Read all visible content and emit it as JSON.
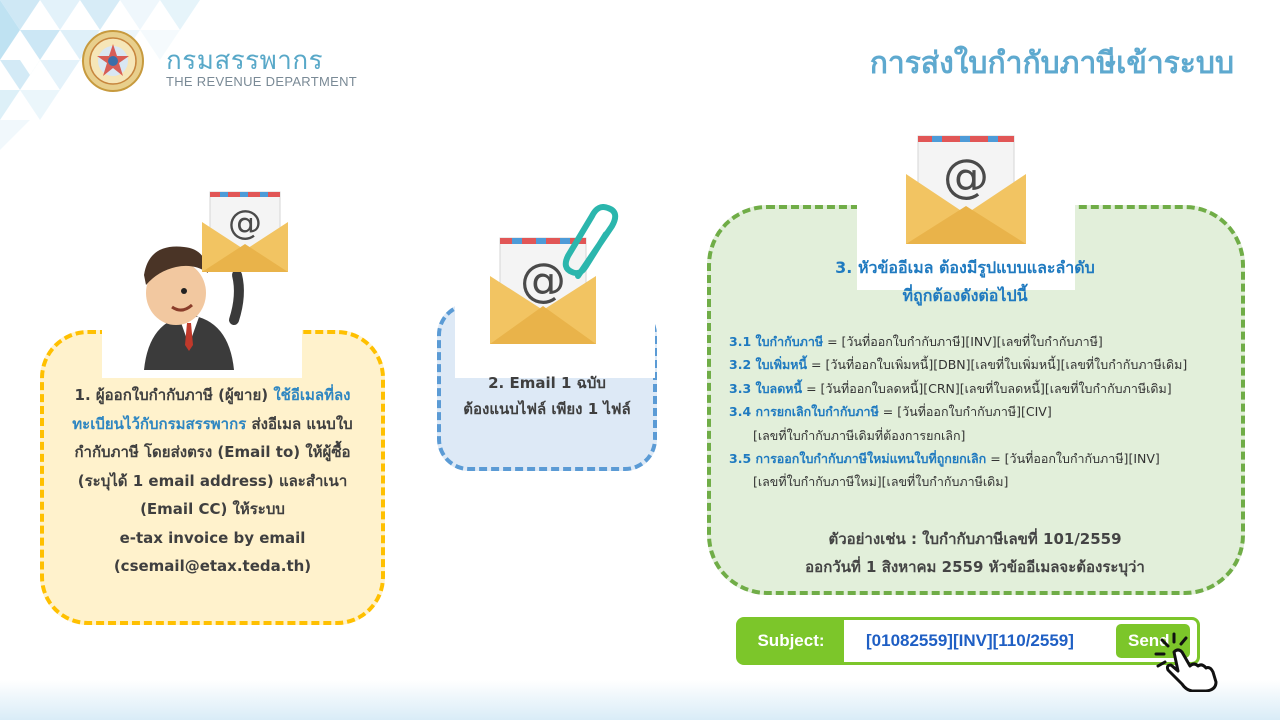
{
  "header": {
    "brand_th": "กรมสรรพากร",
    "brand_en": "THE REVENUE DEPARTMENT",
    "page_title": "การส่งใบกำกับภาษีเข้าระบบ"
  },
  "step1": {
    "prefix": "1. ผู้ออกใบกำกับภาษี (ผู้ขาย) ",
    "highlight": "ใช้อีเมลที่ลงทะเบียนไว้กับกรมสรรพากร",
    "rest": " ส่งอีเมล แนบใบกำกับภาษี โดยส่งตรง (Email to) ให้ผู้ซื้อ (ระบุได้ 1 email address) และสำเนา (Email CC) ให้ระบบ",
    "service": "e-tax invoice by email",
    "email": "(csemail@etax.teda.th)"
  },
  "step2": {
    "line1": "2. Email 1 ฉบับ",
    "line2": "ต้องแนบไฟล์ เพียง 1 ไฟล์"
  },
  "step3": {
    "heading1": "3. หัวข้ออีเมล ต้องมีรูปแบบและลำดับ",
    "heading2": "ที่ถูกต้องดังต่อไปนี้",
    "rules": [
      {
        "num": "3.1 ใบกำกับภาษี",
        "text": " = [วันที่ออกใบกำกับภาษี][INV][เลขที่ใบกำกับภาษี]",
        "cont": ""
      },
      {
        "num": "3.2 ใบเพิ่มหนี้",
        "text": " = [วันที่ออกใบเพิ่มหนี้][DBN][เลขที่ใบเพิ่มหนี้][เลขที่ใบกำกับภาษีเดิม]",
        "cont": ""
      },
      {
        "num": "3.3 ใบลดหนี้",
        "text": " = [วันที่ออกใบลดหนี้][CRN][เลขที่ใบลดหนี้][เลขที่ใบกำกับภาษีเดิม]",
        "cont": ""
      },
      {
        "num": "3.4 การยกเลิกใบกำกับภาษี",
        "text": " = [วันที่ออกใบกำกับภาษี][CIV]",
        "cont": "[เลขที่ใบกำกับภาษีเดิมที่ต้องการยกเลิก]"
      },
      {
        "num": "3.5 การออกใบกำกับภาษีใหม่แทนใบที่ถูกยกเลิก",
        "text": " = [วันที่ออกใบกำกับภาษี][INV]",
        "cont": "[เลขที่ใบกำกับภาษีใหม่][เลขที่ใบกำกับภาษีเดิม]"
      }
    ],
    "example1": "ตัวอย่างเช่น : ใบกำกับภาษีเลขที่ 101/2559",
    "example2": "ออกวันที่ 1 สิงหาคม 2559 หัวข้ออีเมลจะต้องระบุว่า"
  },
  "subject_bar": {
    "label": "Subject:",
    "value": "[01082559][INV][110/2559]",
    "send_label": "Send"
  },
  "colors": {
    "step1_fill": "#fff2cc",
    "step1_border": "#ffc000",
    "step2_fill": "#dde9f6",
    "step2_border": "#5b9bd5",
    "step3_fill": "#e2efda",
    "step3_border": "#70ad47",
    "accent_blue": "#1f7ac0",
    "subject_green": "#7cc62a"
  },
  "icons": [
    "revenue-department-logo",
    "envelope-at-icon",
    "paperclip-icon",
    "businessman-illustration",
    "click-hand-icon"
  ]
}
